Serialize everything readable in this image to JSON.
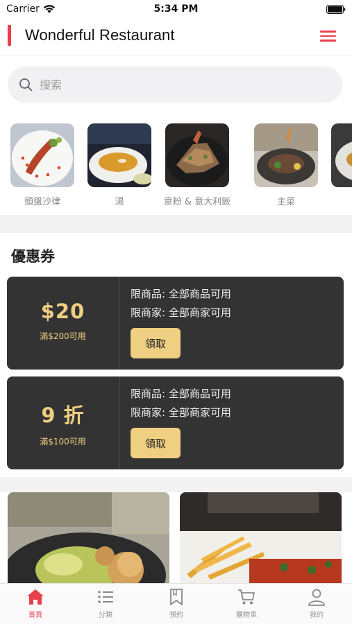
{
  "status_bar": {
    "carrier": "Carrier",
    "time": "5:34 PM"
  },
  "header": {
    "title": "Wonderful Restaurant",
    "accent_color": "#e8404c"
  },
  "search": {
    "placeholder": "搜索"
  },
  "categories": [
    {
      "label": "頭盤沙律"
    },
    {
      "label": "湯"
    },
    {
      "label": "意粉 & 意大利飯"
    },
    {
      "label": "主菜"
    }
  ],
  "coupons": {
    "title": "優惠券",
    "items": [
      {
        "amount": "$20",
        "condition": "滿$200可用",
        "line1": "限商品: 全部商品可用",
        "line2": "限商家: 全部商家可用",
        "button": "領取"
      },
      {
        "amount": "9 折",
        "condition": "滿$100可用",
        "line1": "限商品: 全部商品可用",
        "line2": "限商家: 全部商家可用",
        "button": "領取"
      }
    ],
    "card_color": "#333333",
    "gold_color": "#efcf82"
  },
  "tab_bar": {
    "tabs": [
      {
        "label": "首頁",
        "icon": "home-icon",
        "active": true
      },
      {
        "label": "分類",
        "icon": "list-icon",
        "active": false
      },
      {
        "label": "預約",
        "icon": "bookmark-icon",
        "active": false
      },
      {
        "label": "購物車",
        "icon": "cart-icon",
        "active": false
      },
      {
        "label": "我的",
        "icon": "user-icon",
        "active": false
      }
    ]
  }
}
